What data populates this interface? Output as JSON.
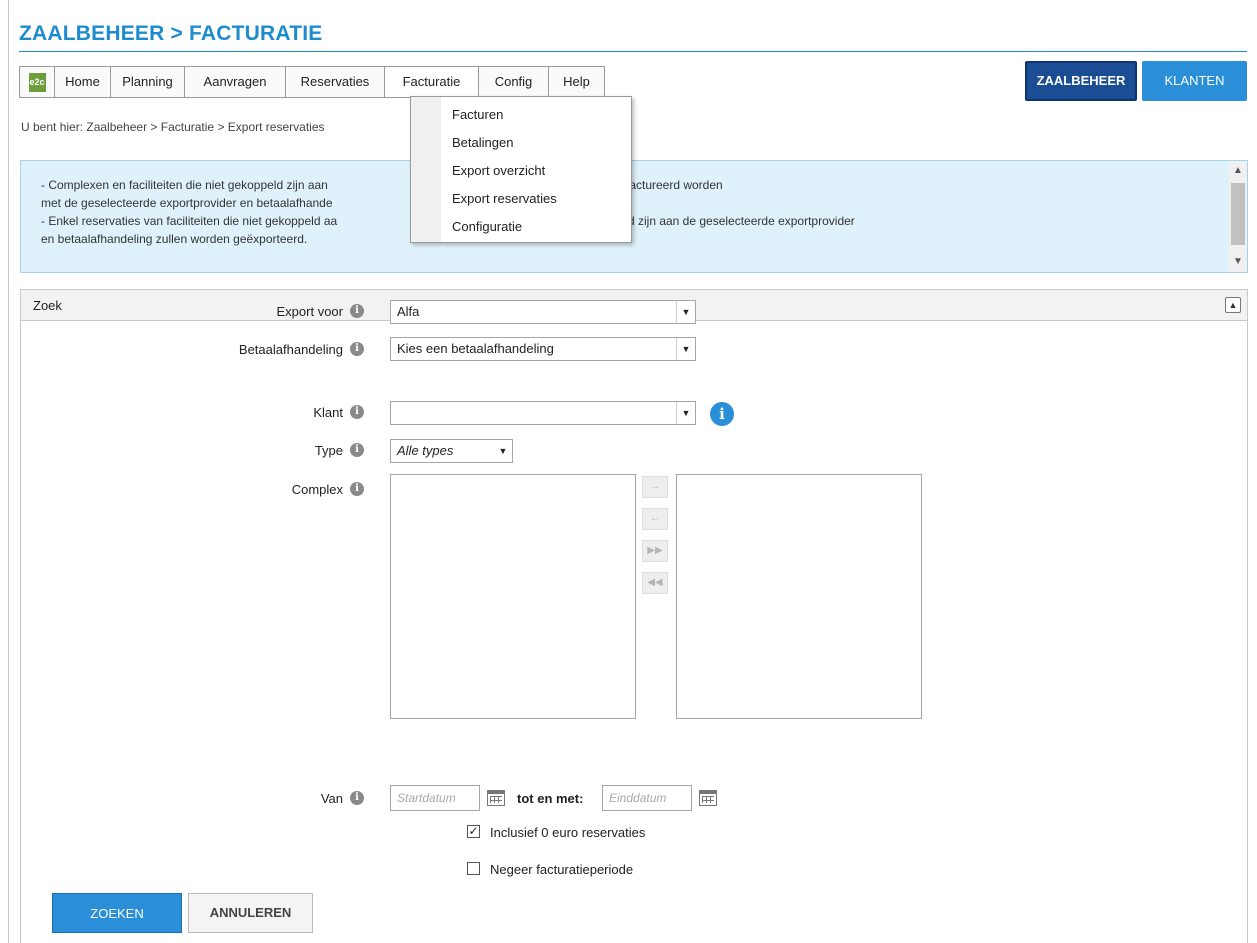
{
  "page": {
    "title": "ZAALBEHEER > FACTURATIE"
  },
  "nav": {
    "logo_text": "e2c",
    "items": [
      "Home",
      "Planning",
      "Aanvragen",
      "Reservaties",
      "Facturatie",
      "Config",
      "Help"
    ],
    "active": "Facturatie"
  },
  "top_buttons": {
    "zaalbeheer": "ZAALBEHEER",
    "klanten": "KLANTEN"
  },
  "breadcrumb": "U bent hier: Zaalbeheer > Facturatie > Export reservaties",
  "dropdown": {
    "items": [
      "Facturen",
      "Betalingen",
      "Export overzicht",
      "Export reservaties",
      "Configuratie"
    ]
  },
  "info_box": {
    "lines": [
      "- Complexen en faciliteiten die niet gekoppeld zijn aan                                                        handeling kunnen gefactureerd worden",
      "met de geselecteerde exportprovider en betaalafhande",
      "- Enkel reservaties van faciliteiten die niet gekoppeld aa                                                    handeling of gekoppeld zijn aan de geselecteerde exportprovider",
      "en betaalafhandeling zullen worden geëxporteerd."
    ]
  },
  "search_panel": {
    "title": "Zoek",
    "export_voor": {
      "label": "Export voor",
      "value": "Alfa"
    },
    "betaalafhandeling": {
      "label": "Betaalafhandeling",
      "value": "Kies een betaalafhandeling"
    },
    "klant": {
      "label": "Klant",
      "value": ""
    },
    "type": {
      "label": "Type",
      "value": "Alle types"
    },
    "complex": {
      "label": "Complex"
    },
    "van": {
      "label": "Van",
      "start_placeholder": "Startdatum",
      "tot_label": "tot en met:",
      "end_placeholder": "Einddatum"
    },
    "checkboxes": [
      {
        "label": "Inclusief 0 euro reservaties",
        "checked": true
      },
      {
        "label": "Negeer facturatieperiode",
        "checked": false
      }
    ],
    "buttons": {
      "search": "ZOEKEN",
      "cancel": "ANNULEREN"
    }
  }
}
